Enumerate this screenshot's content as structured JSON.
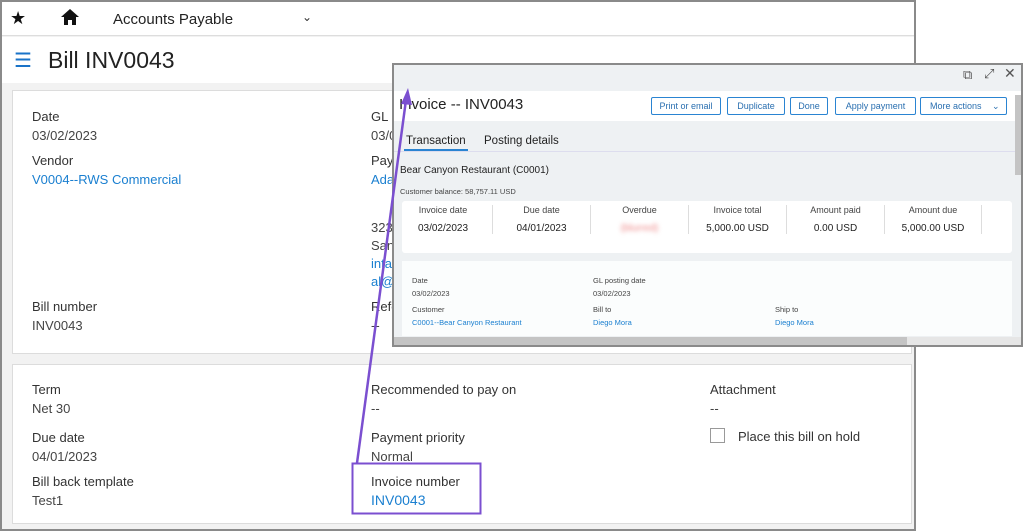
{
  "topbar": {
    "title": "Accounts Payable"
  },
  "page": {
    "title": "Bill INV0043"
  },
  "bill": {
    "date_label": "Date",
    "date": "03/02/2023",
    "gl_label": "GL p",
    "gl_value": "03/0",
    "vendor_label": "Vendor",
    "vendor": "V0004--RWS Commercial",
    "pay_label": "Pay",
    "pay_value": "Ada",
    "address": [
      "323",
      "San",
      "inta",
      "al@"
    ],
    "bill_number_label": "Bill number",
    "bill_number": "INV0043",
    "ref_label": "Refe",
    "ref_value": "--"
  },
  "details": {
    "term_label": "Term",
    "term": "Net 30",
    "due_label": "Due date",
    "due": "04/01/2023",
    "template_label": "Bill back template",
    "template": "Test1",
    "recommended_label": "Recommended to pay on",
    "recommended": "--",
    "priority_label": "Payment priority",
    "priority": "Normal",
    "invoice_label": "Invoice number",
    "invoice": "INV0043",
    "attachment_label": "Attachment",
    "attachment": "--",
    "hold_label": "Place this bill on hold",
    "hold_checked": false
  },
  "popup": {
    "title": "Invoice -- INV0043",
    "buttons": [
      "Print or email",
      "Duplicate",
      "Done",
      "Apply payment",
      "More actions"
    ],
    "tabs": [
      "Transaction",
      "Posting details"
    ],
    "customer_name": "Bear Canyon Restaurant (C0001)",
    "balance": "Customer balance: 58,757.11 USD",
    "stats": [
      {
        "label": "Invoice date",
        "value": "03/02/2023"
      },
      {
        "label": "Due date",
        "value": "04/01/2023"
      },
      {
        "label": "Overdue",
        "value": "(blurred)"
      },
      {
        "label": "Invoice total",
        "value": "5,000.00 USD"
      },
      {
        "label": "Amount paid",
        "value": "0.00 USD"
      },
      {
        "label": "Amount due",
        "value": "5,000.00 USD"
      }
    ],
    "fields": {
      "date_label": "Date",
      "date": "03/02/2023",
      "gl_label": "GL posting date",
      "gl": "03/02/2023",
      "customer_label": "Customer",
      "customer": "C0001--Bear Canyon Restaurant",
      "billto_label": "Bill to",
      "billto": "Diego Mora",
      "shipto_label": "Ship to",
      "shipto": "Diego Mora"
    }
  },
  "colors": {
    "accent": "#1a7fd0",
    "annotation": "#7b4fd0"
  }
}
